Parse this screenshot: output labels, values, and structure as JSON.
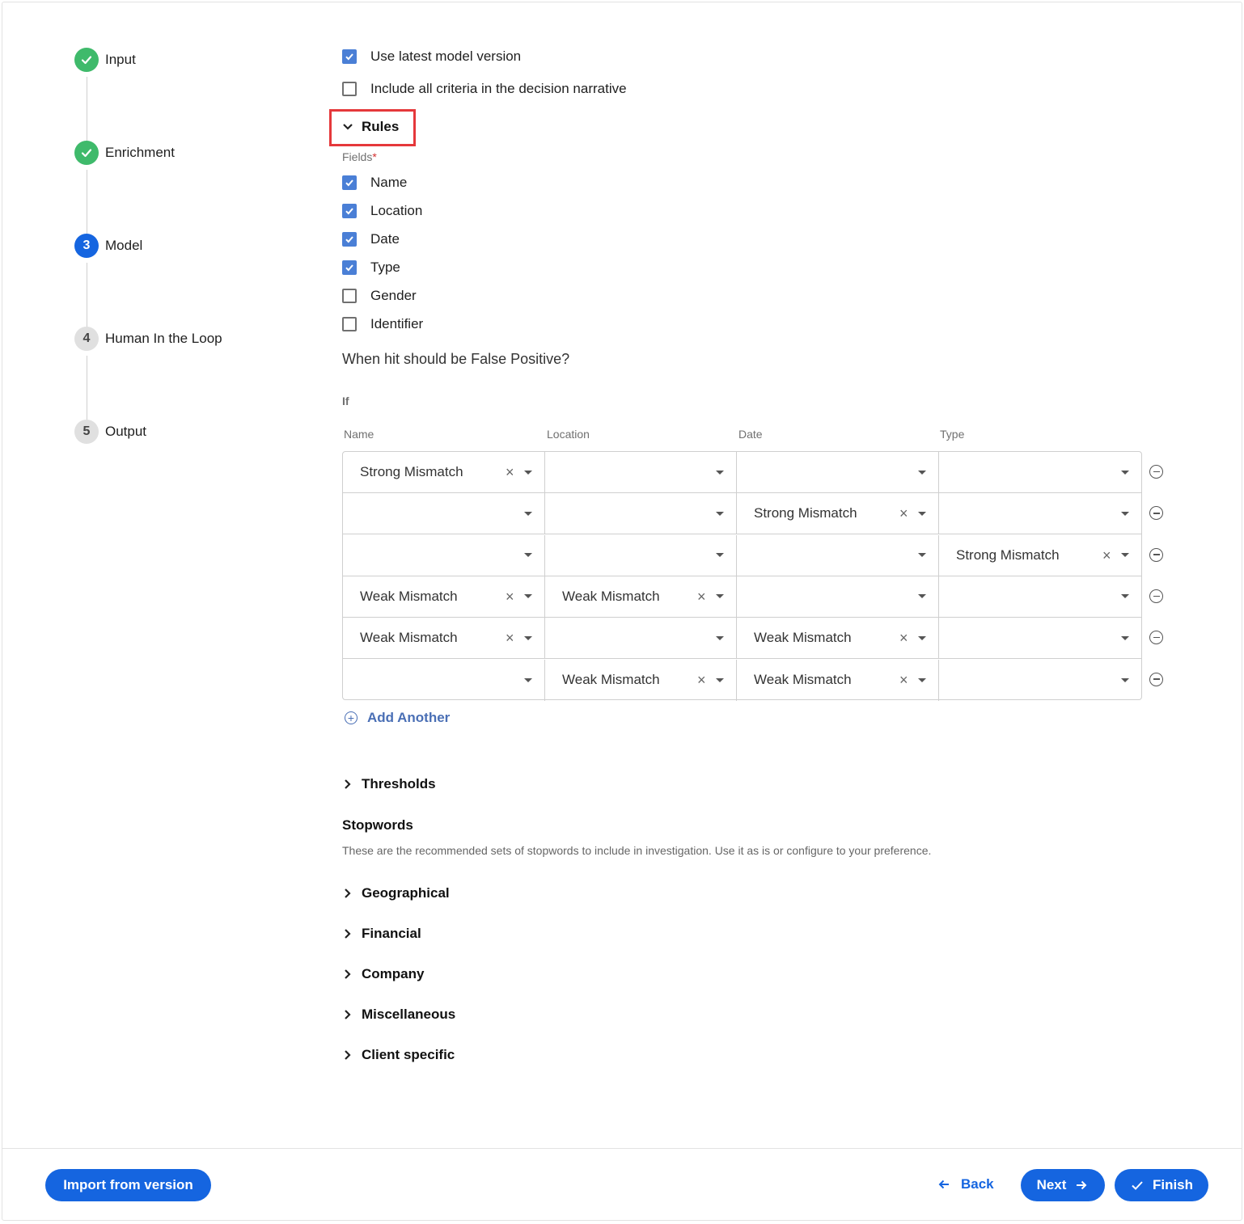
{
  "stepper": {
    "steps": [
      {
        "number": "",
        "label": "Input",
        "status": "done"
      },
      {
        "number": "",
        "label": "Enrichment",
        "status": "done"
      },
      {
        "number": "3",
        "label": "Model",
        "status": "active"
      },
      {
        "number": "4",
        "label": "Human In the Loop",
        "status": "todo"
      },
      {
        "number": "5",
        "label": "Output",
        "status": "todo"
      }
    ]
  },
  "options": {
    "use_latest": {
      "label": "Use latest model version",
      "checked": true
    },
    "include_all": {
      "label": "Include all criteria in the decision narrative",
      "checked": false
    }
  },
  "rules": {
    "title": "Rules",
    "fields_label": "Fields",
    "required_mark": "*",
    "fields": [
      {
        "label": "Name",
        "checked": true
      },
      {
        "label": "Location",
        "checked": true
      },
      {
        "label": "Date",
        "checked": true
      },
      {
        "label": "Type",
        "checked": true
      },
      {
        "label": "Gender",
        "checked": false
      },
      {
        "label": "Identifier",
        "checked": false
      }
    ],
    "question": "When hit should be False Positive?",
    "if_label": "If",
    "columns": [
      "Name",
      "Location",
      "Date",
      "Type"
    ],
    "rows": [
      [
        "Strong Mismatch",
        "",
        "",
        ""
      ],
      [
        "",
        "",
        "Strong Mismatch",
        ""
      ],
      [
        "",
        "",
        "",
        "Strong Mismatch"
      ],
      [
        "Weak Mismatch",
        "Weak Mismatch",
        "",
        ""
      ],
      [
        "Weak Mismatch",
        "",
        "Weak Mismatch",
        ""
      ],
      [
        "",
        "Weak Mismatch",
        "Weak Mismatch",
        ""
      ]
    ],
    "add_another": "Add Another"
  },
  "thresholds": {
    "title": "Thresholds"
  },
  "stopwords": {
    "title": "Stopwords",
    "description": "These are the recommended sets of stopwords to include in investigation. Use it as is or configure to your preference.",
    "groups": [
      "Geographical",
      "Financial",
      "Company",
      "Miscellaneous",
      "Client specific"
    ]
  },
  "footer": {
    "import_label": "Import from version",
    "back_label": "Back",
    "next_label": "Next",
    "finish_label": "Finish"
  },
  "colors": {
    "primary": "#1565e0",
    "done": "#3fba6b",
    "checkbox": "#4a7fd6",
    "highlight_box": "#e5383b",
    "link": "#4a6fb5"
  }
}
